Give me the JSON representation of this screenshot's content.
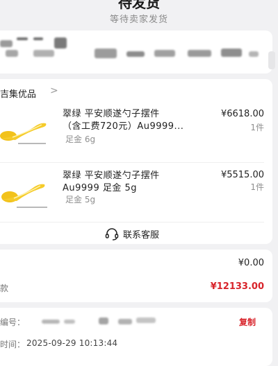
{
  "header": {
    "title": "待发货",
    "subtitle": "等待卖家发货"
  },
  "store": {
    "name": "吉集优品",
    "chevron": ">"
  },
  "products": [
    {
      "title_line1": "翠绿 平安顺遂勺子摆件",
      "title_line2": "（含工费720元）Au9999...",
      "spec": "足金 6g",
      "price": "¥6618.00",
      "qty": "1件"
    },
    {
      "title_line1": "翠绿 平安顺遂勺子摆件",
      "title_line2": "Au9999 足金 5g",
      "spec": "足金 5g",
      "price": "¥5515.00",
      "qty": "1件"
    }
  ],
  "contact": {
    "label": "联系客服",
    "icon": "headset-icon"
  },
  "amounts": {
    "row1_value": "¥0.00",
    "total_label": "款",
    "total_value": "¥12133.00"
  },
  "order_info": {
    "number_label": "编号：",
    "copy_label": "复制",
    "time_label": "时间：",
    "time_value": "2025-09-29 10:13:44"
  },
  "colors": {
    "accent": "#d8232a",
    "background": "#f1f1f3",
    "gold": "#f2c21b"
  }
}
